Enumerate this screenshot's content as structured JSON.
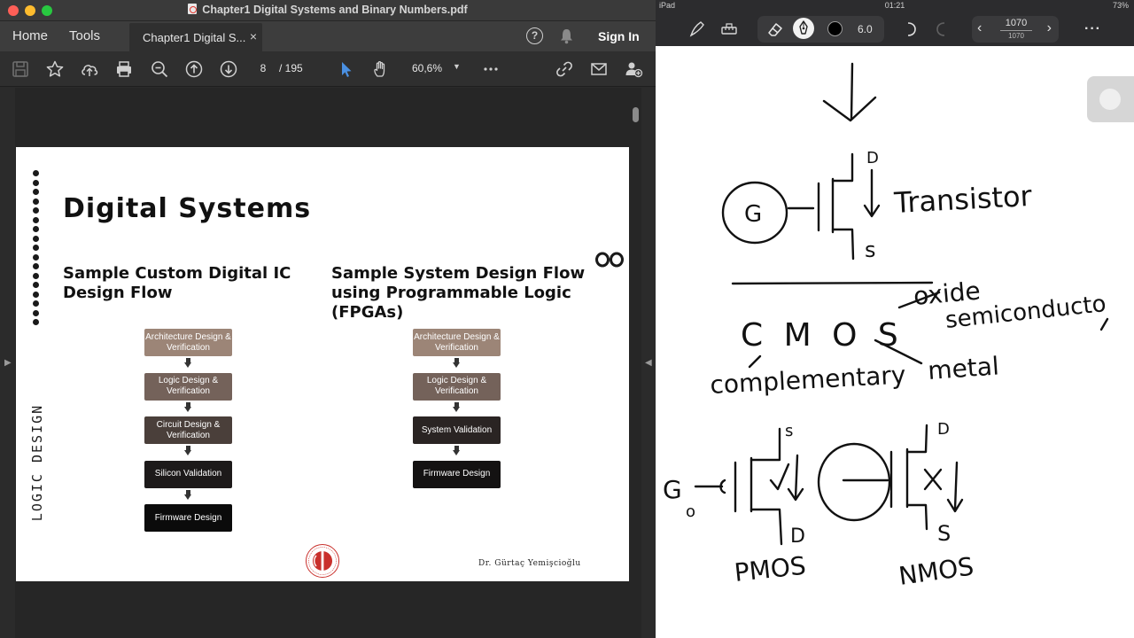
{
  "pdf_window": {
    "title": "Chapter1 Digital Systems and Binary Numbers.pdf",
    "nav": {
      "home": "Home",
      "tools": "Tools"
    },
    "tab": {
      "label": "Chapter1 Digital S...",
      "close": "×"
    },
    "help_glyph": "?",
    "sign_in": "Sign In",
    "toolbar": {
      "current_page": "8",
      "page_total": "/  195",
      "zoom": "60,6%",
      "icons": [
        "save-icon",
        "bookmark-star-icon",
        "upload-cloud-icon",
        "print-icon",
        "zoom-out-icon",
        "page-up-icon",
        "page-down-icon",
        "select-pointer-icon",
        "hand-pan-icon",
        "zoom-dropdown",
        "more-icon",
        "share-link-icon",
        "mail-icon",
        "add-user-icon"
      ]
    },
    "slide": {
      "side_label": "LOGIC  DESIGN",
      "title": "Digital Systems",
      "column1_title": "Sample Custom Digital IC Design Flow",
      "column2_title": "Sample System Design Flow using Programmable Logic (FPGAs)",
      "flow1": [
        {
          "label": "Architecture Design & Verification",
          "color": "#9c8577"
        },
        {
          "label": "Logic Design & Verification",
          "color": "#74625a"
        },
        {
          "label": "Circuit Design & Verification",
          "color": "#4a3f3a"
        },
        {
          "label": "Silicon Validation",
          "color": "#1d1a1a"
        },
        {
          "label": "Firmware Design",
          "color": "#0b0b0b"
        }
      ],
      "flow2": [
        {
          "label": "Architecture Design & Verification",
          "color": "#9c8577"
        },
        {
          "label": "Logic Design & Verification",
          "color": "#74625a"
        },
        {
          "label": "System Validation",
          "color": "#2a2423"
        },
        {
          "label": "Firmware Design",
          "color": "#141212"
        }
      ],
      "author": "Dr. Gürtaç Yemişcioğlu",
      "logo": "infinity-logo",
      "seal": "university-seal"
    }
  },
  "notes_app": {
    "status": {
      "device": "iPad",
      "time": "01:21",
      "battery": "73%"
    },
    "pen_size": "6.0",
    "pen_color": "#000000",
    "page": {
      "current": "1070",
      "total": "1070"
    },
    "toolbar_icons": [
      "pen-mode-icon",
      "ruler-icon",
      "eraser-icon",
      "fountain-pen-icon",
      "undo-icon",
      "redo-icon",
      "prev-page-icon",
      "next-page-icon",
      "more-icon"
    ],
    "handwriting": {
      "transistor": "Transistor",
      "s_top": "s",
      "d_top": "D",
      "gate_letter": "G",
      "oxide": "oxide",
      "cmos": "C M O S",
      "semiconductor": "semiconducto",
      "complementary": "complementary",
      "metal": "metal",
      "pmos_s": "s",
      "pmos_d": "D",
      "pmos_g": "G",
      "pmos_zero": "o",
      "nmos_d": "D",
      "nmos_s": "S",
      "pmos": "PMOS",
      "nmos": "NMOS"
    }
  }
}
